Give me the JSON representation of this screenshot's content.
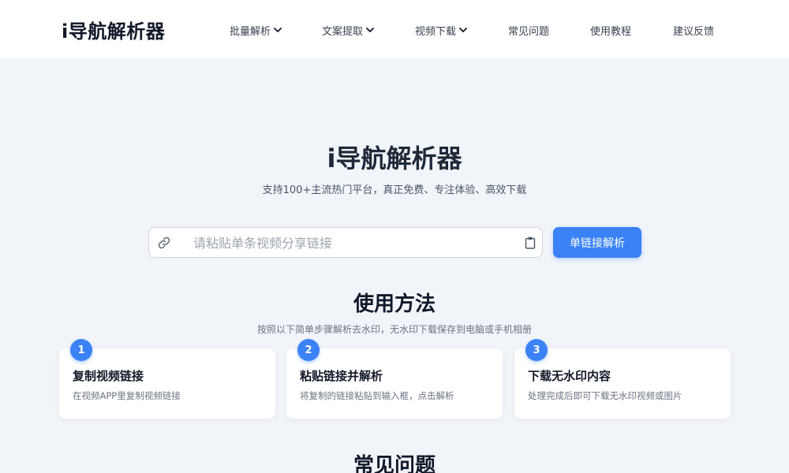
{
  "header": {
    "logo": "i导航解析器",
    "nav": [
      {
        "label": "批量解析",
        "dropdown": true
      },
      {
        "label": "文案提取",
        "dropdown": true
      },
      {
        "label": "视频下载",
        "dropdown": true
      },
      {
        "label": "常见问题",
        "dropdown": false
      },
      {
        "label": "使用教程",
        "dropdown": false
      },
      {
        "label": "建议反馈",
        "dropdown": false
      }
    ]
  },
  "hero": {
    "title": "i导航解析器",
    "subtitle": "支持100+主流热门平台，真正免费、专注体验、高效下载"
  },
  "search": {
    "placeholder": "请粘贴单条视频分享链接",
    "value": "",
    "button_label": "单链接解析"
  },
  "usage": {
    "title": "使用方法",
    "subtitle": "按照以下简单步骤解析去水印，无水印下载保存到电脑或手机相册",
    "steps": [
      {
        "number": "1",
        "title": "复制视频链接",
        "desc": "在视频APP里复制视频链接"
      },
      {
        "number": "2",
        "title": "粘贴链接并解析",
        "desc": "将复制的链接粘贴到输入框，点击解析"
      },
      {
        "number": "3",
        "title": "下载无水印内容",
        "desc": "处理完成后即可下载无水印视频或图片"
      }
    ]
  },
  "faq": {
    "title": "常见问题"
  },
  "colors": {
    "accent": "#3b82f6",
    "background": "#f1f5fa",
    "header_bg": "#ffffff"
  }
}
